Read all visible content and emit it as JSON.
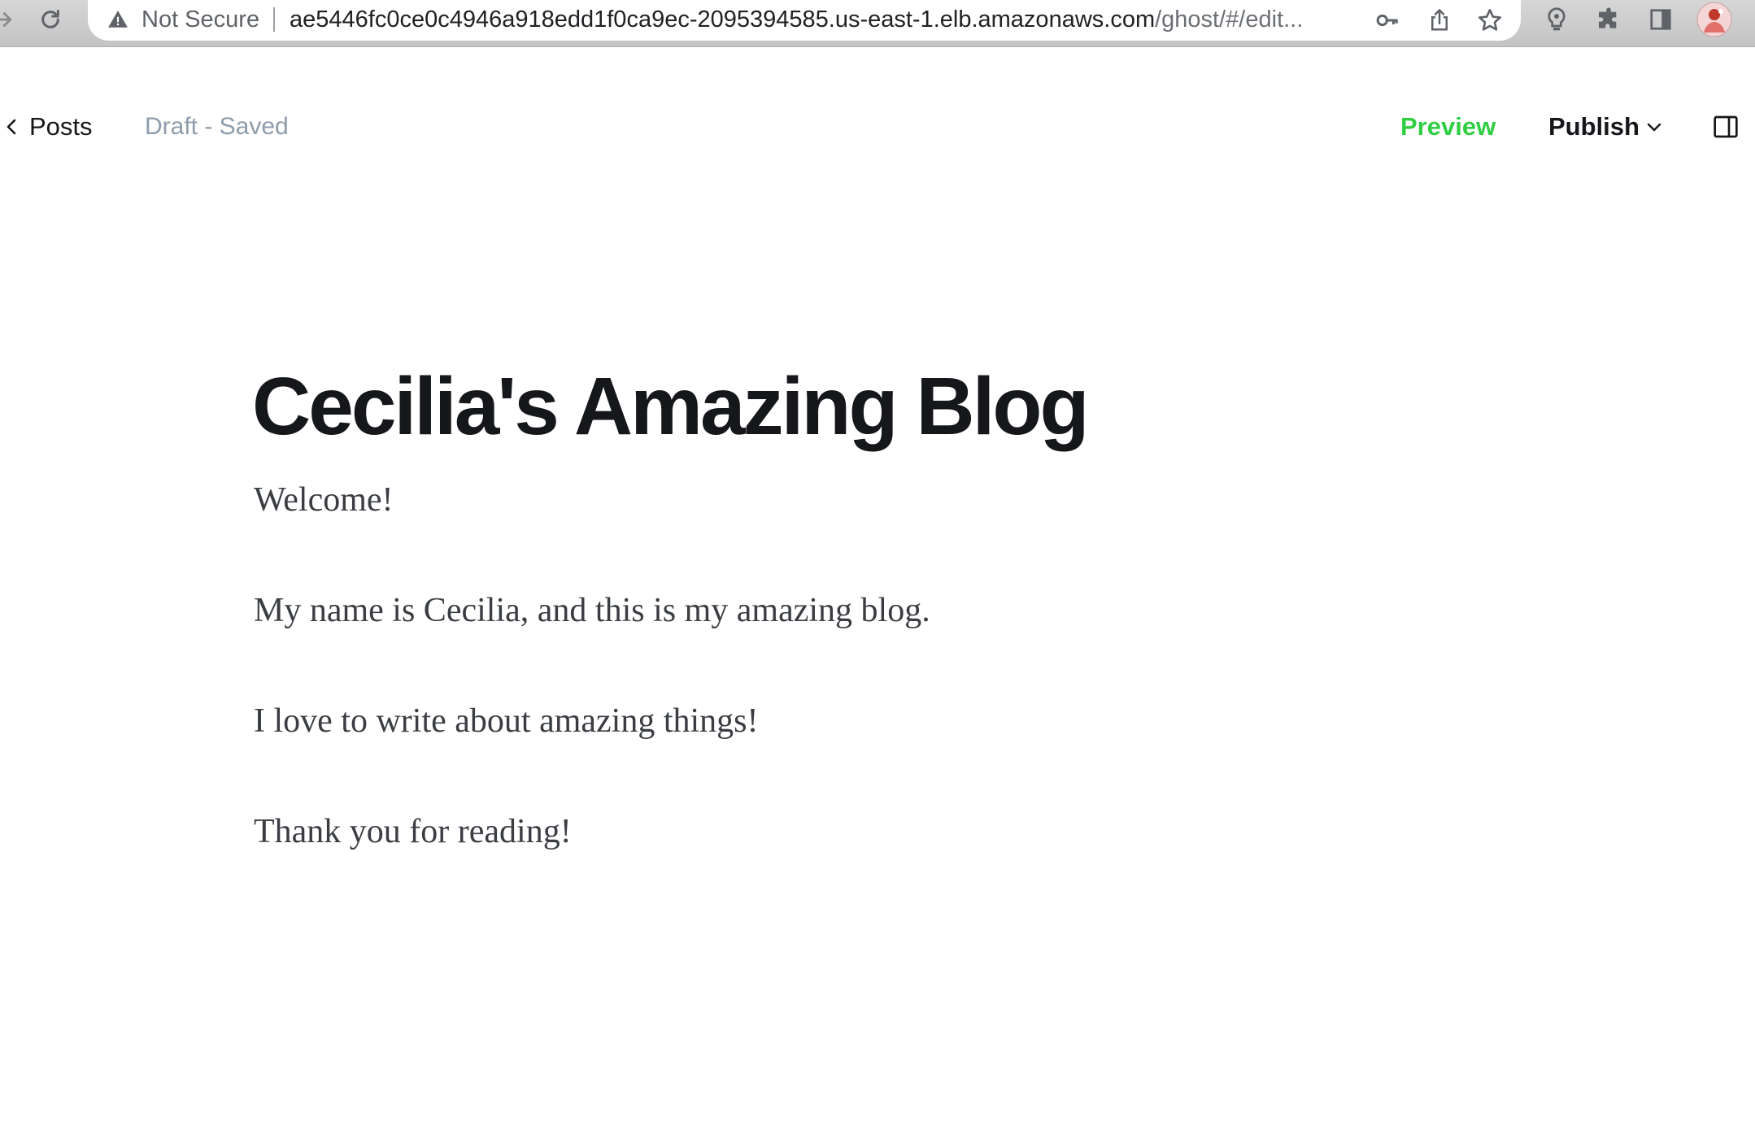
{
  "browser": {
    "security_status": "Not Secure",
    "url_host": "ae5446fc0ce0c4946a918edd1f0ca9ec-2095394585.us-east-1.elb.amazonaws.com",
    "url_path": "/ghost/#/edit...",
    "icons": [
      "forward-icon",
      "reload-icon",
      "warning-icon",
      "key-icon",
      "share-icon",
      "star-icon",
      "bulb-icon",
      "puzzle-icon",
      "sidepanel-icon",
      "profile-avatar"
    ]
  },
  "editor": {
    "back_label": "Posts",
    "status": "Draft - Saved",
    "preview_label": "Preview",
    "publish_label": "Publish"
  },
  "post": {
    "title": "Cecilia's Amazing Blog",
    "paragraphs": [
      "Welcome!",
      "My name is Cecilia, and this is my amazing blog.",
      "I love to write about amazing things!",
      "Thank you for reading!"
    ]
  },
  "colors": {
    "preview_green": "#30cf43",
    "status_gray": "#8e9cac",
    "title_black": "#15171a",
    "body_text": "#3a3d42"
  }
}
